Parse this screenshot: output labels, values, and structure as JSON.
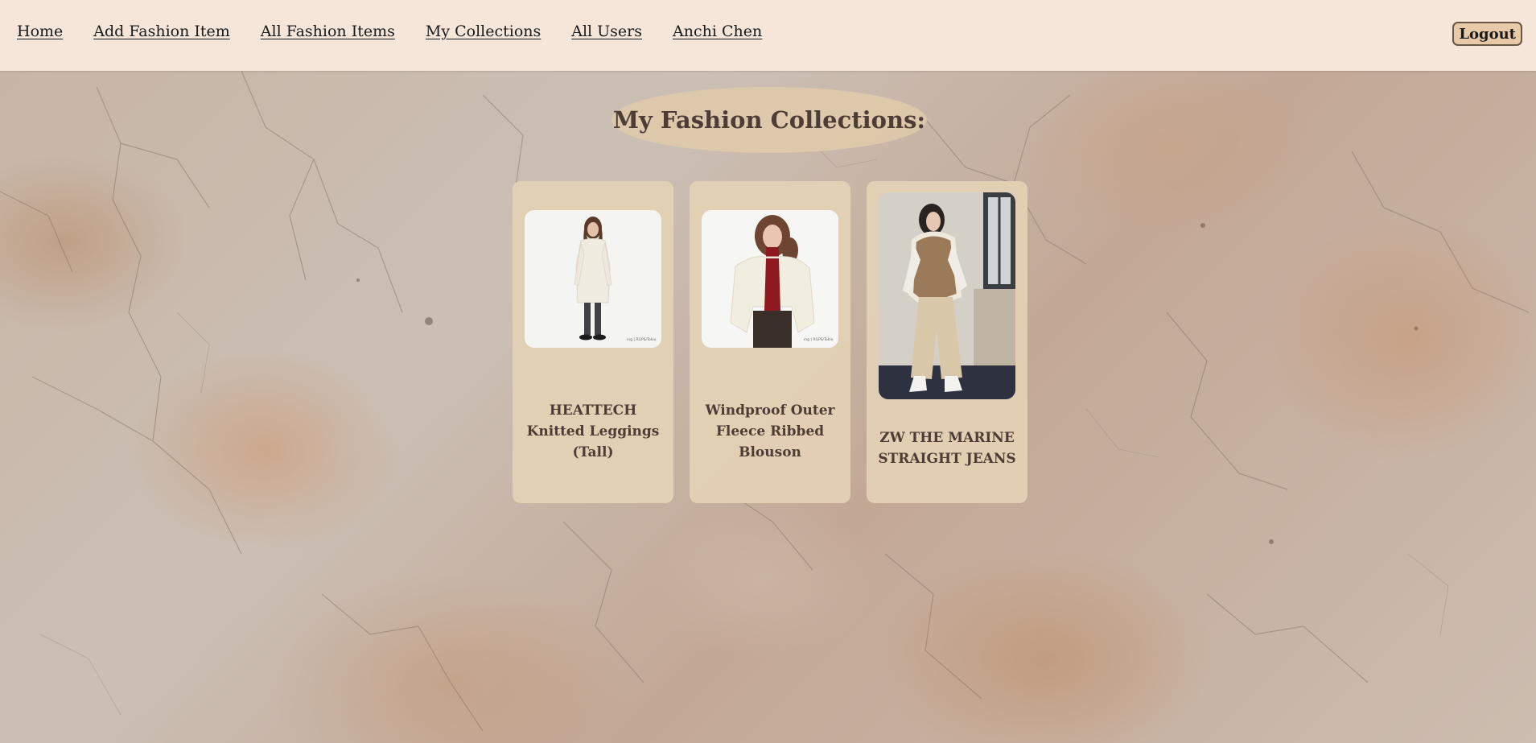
{
  "nav": {
    "items": [
      {
        "label": "Home"
      },
      {
        "label": "Add Fashion Item"
      },
      {
        "label": "All Fashion Items"
      },
      {
        "label": "My Collections"
      },
      {
        "label": "All Users"
      },
      {
        "label": "Anchi Chen"
      }
    ],
    "logout_label": "Logout"
  },
  "main": {
    "title": "My Fashion Collections:"
  },
  "collections": [
    {
      "title": "HEATTECH Knitted Leggings (Tall)",
      "image_caption": "ing | RGPS/Tokio"
    },
    {
      "title": "Windproof Outer Fleece Ribbed Blouson",
      "image_caption": "ing | RGPS/Tokio"
    },
    {
      "title": "ZW THE MARINE STRAIGHT JEANS"
    }
  ],
  "colors": {
    "navbar_bg": "#f5e6d9",
    "card_bg": "#e3d1b5",
    "title_text": "#4d3d36",
    "logout_bg": "#e8c9a8"
  }
}
